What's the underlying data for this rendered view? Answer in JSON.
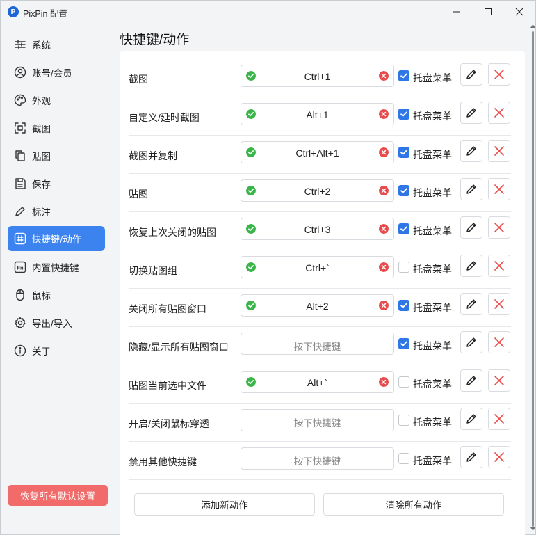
{
  "window": {
    "title": "PixPin 配置",
    "logo_letter": "P",
    "accent": "#3c83f0",
    "danger": "#f26b6b"
  },
  "sidebar": {
    "items": [
      {
        "label": "系统",
        "icon": "sliders-icon",
        "active": false
      },
      {
        "label": "账号/会员",
        "icon": "user-circle-icon",
        "active": false
      },
      {
        "label": "外观",
        "icon": "palette-icon",
        "active": false
      },
      {
        "label": "截图",
        "icon": "screenshot-frame-icon",
        "active": false
      },
      {
        "label": "贴图",
        "icon": "copy-pages-icon",
        "active": false
      },
      {
        "label": "保存",
        "icon": "save-icon",
        "active": false
      },
      {
        "label": "标注",
        "icon": "pen-icon",
        "active": false
      },
      {
        "label": "快捷键/动作",
        "icon": "hash-key-icon",
        "active": true
      },
      {
        "label": "内置快捷键",
        "icon": "fn-key-icon",
        "active": false
      },
      {
        "label": "鼠标",
        "icon": "mouse-icon",
        "active": false
      },
      {
        "label": "导出/导入",
        "icon": "gear-icon",
        "active": false
      },
      {
        "label": "关于",
        "icon": "info-icon",
        "active": false
      }
    ],
    "reset_label": "恢复所有默认设置"
  },
  "main": {
    "title": "快捷键/动作",
    "tray_label": "托盘菜单",
    "placeholder": "按下快捷键",
    "rows": [
      {
        "label": "截图",
        "hotkey": "Ctrl+1",
        "tray": true
      },
      {
        "label": "自定义/延时截图",
        "hotkey": "Alt+1",
        "tray": true
      },
      {
        "label": "截图并复制",
        "hotkey": "Ctrl+Alt+1",
        "tray": true
      },
      {
        "label": "贴图",
        "hotkey": "Ctrl+2",
        "tray": true
      },
      {
        "label": "恢复上次关闭的贴图",
        "hotkey": "Ctrl+3",
        "tray": true
      },
      {
        "label": "切换贴图组",
        "hotkey": "Ctrl+`",
        "tray": false
      },
      {
        "label": "关闭所有贴图窗口",
        "hotkey": "Alt+2",
        "tray": true
      },
      {
        "label": "隐藏/显示所有贴图窗口",
        "hotkey": "",
        "tray": true
      },
      {
        "label": "贴图当前选中文件",
        "hotkey": "Alt+`",
        "tray": false
      },
      {
        "label": "开启/关闭鼠标穿透",
        "hotkey": "",
        "tray": false
      },
      {
        "label": "禁用其他快捷键",
        "hotkey": "",
        "tray": false
      }
    ],
    "add_label": "添加新动作",
    "clear_label": "清除所有动作"
  }
}
